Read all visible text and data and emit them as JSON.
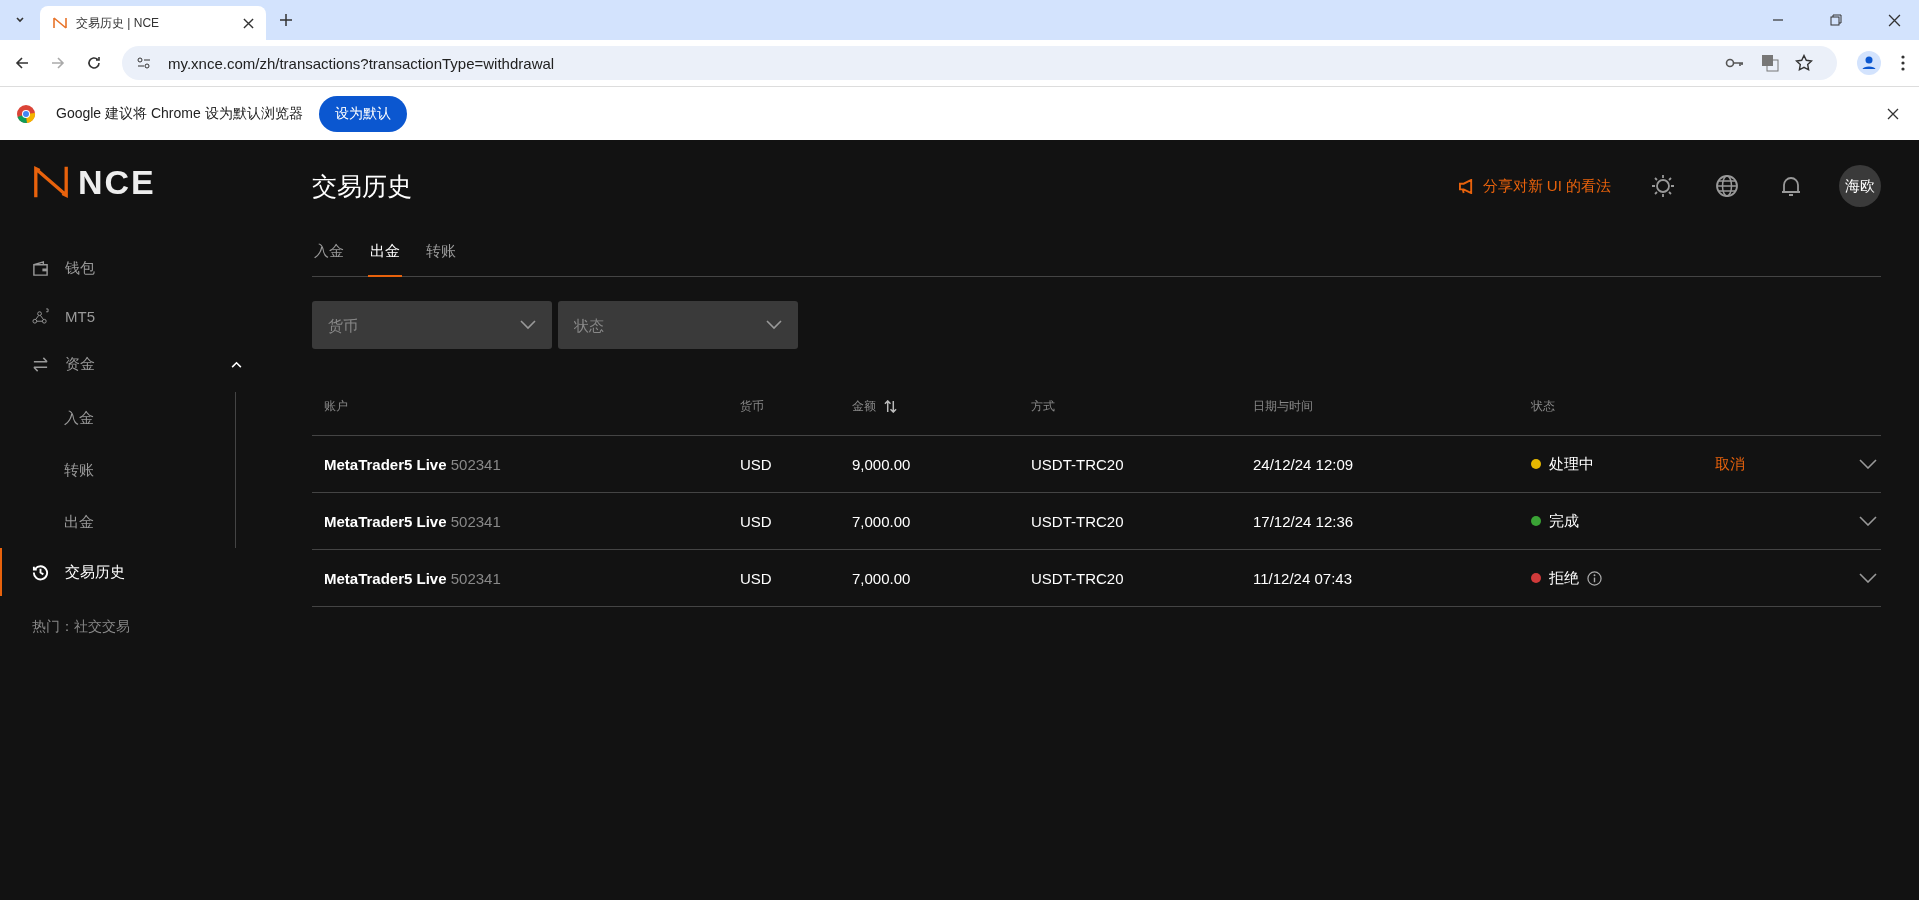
{
  "browser": {
    "tab_title": "交易历史 | NCE",
    "url": "my.xnce.com/zh/transactions?transactionType=withdrawal",
    "infobar": {
      "message": "Google 建议将 Chrome 设为默认浏览器",
      "button": "设为默认"
    }
  },
  "logo": "NCE",
  "sidebar": {
    "items": [
      {
        "label": "钱包",
        "selected": false
      },
      {
        "label": "MT5",
        "selected": false
      },
      {
        "label": "资金",
        "selected": false,
        "expanded": true,
        "children": [
          {
            "label": "入金",
            "selected": false
          },
          {
            "label": "转账",
            "selected": false
          },
          {
            "label": "出金",
            "selected": false
          }
        ]
      },
      {
        "label": "交易历史",
        "selected": true
      }
    ],
    "footer": "热门：社交交易"
  },
  "header": {
    "title": "交易历史",
    "feedback": "分享对新 UI 的看法",
    "avatar": "海欧"
  },
  "tabs": [
    {
      "label": "入金",
      "selected": false
    },
    {
      "label": "出金",
      "selected": true
    },
    {
      "label": "转账",
      "selected": false
    }
  ],
  "filters": [
    {
      "placeholder": "货币"
    },
    {
      "placeholder": "状态"
    }
  ],
  "table": {
    "columns": [
      {
        "label": "账户",
        "sortable": false
      },
      {
        "label": "货币",
        "sortable": false
      },
      {
        "label": "金额",
        "sortable": true
      },
      {
        "label": "方式",
        "sortable": false
      },
      {
        "label": "日期与时间",
        "sortable": false
      },
      {
        "label": "状态",
        "sortable": false
      }
    ],
    "rows": [
      {
        "account": "MetaTrader5 Live",
        "account_number": "502341",
        "currency": "USD",
        "amount": "9,000.00",
        "method": "USDT-TRC20",
        "datetime": "24/12/24 12:09",
        "status": {
          "label": "处理中",
          "color": "#e6b800",
          "info": false
        },
        "action": "取消"
      },
      {
        "account": "MetaTrader5 Live",
        "account_number": "502341",
        "currency": "USD",
        "amount": "7,000.00",
        "method": "USDT-TRC20",
        "datetime": "17/12/24 12:36",
        "status": {
          "label": "完成",
          "color": "#3aa335",
          "info": false
        }
      },
      {
        "account": "MetaTrader5 Live",
        "account_number": "502341",
        "currency": "USD",
        "amount": "7,000.00",
        "method": "USDT-TRC20",
        "datetime": "11/12/24 07:43",
        "status": {
          "label": "拒绝",
          "color": "#d03a3a",
          "info": true
        }
      }
    ]
  }
}
